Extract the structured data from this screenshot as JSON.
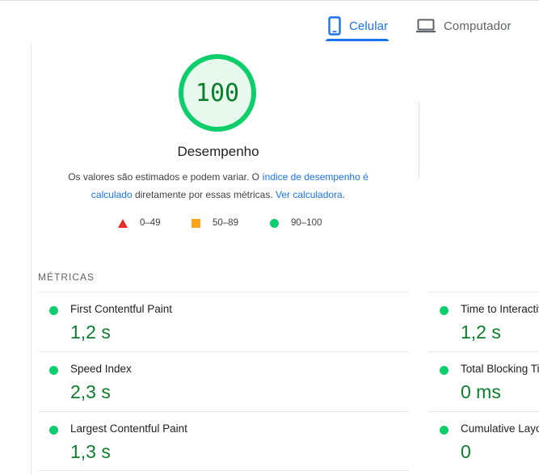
{
  "tabs": [
    {
      "label": "Celular",
      "icon": "smartphone-icon",
      "selected": true
    },
    {
      "label": "Computador",
      "icon": "laptop-icon",
      "selected": false
    }
  ],
  "gauge": {
    "score": "100",
    "score_fraction": 1.0,
    "title": "Desempenho",
    "color": "#0cce6b"
  },
  "description": {
    "text_1": "Os valores são estimados e podem variar. O ",
    "link_1": "índice de desempenho é calculado",
    "text_2": " diretamente por essas métricas. ",
    "link_2": "Ver calculadora",
    "text_3": "."
  },
  "legend": [
    {
      "range": "0–49",
      "shape": "triangle",
      "color": "#eb2a2a"
    },
    {
      "range": "50–89",
      "shape": "square",
      "color": "#ffa31f"
    },
    {
      "range": "90–100",
      "shape": "circle",
      "color": "#0cce6b"
    }
  ],
  "metrics_header": "MÉTRICAS",
  "metrics": [
    {
      "title": "First Contentful Paint",
      "value": "1,2 s"
    },
    {
      "title": "Time to Interactive",
      "value": "1,2 s"
    },
    {
      "title": "Speed Index",
      "value": "2,3 s"
    },
    {
      "title": "Total Blocking Time",
      "value": "0 ms"
    },
    {
      "title": "Largest Contentful Paint",
      "value": "1,3 s"
    },
    {
      "title": "Cumulative Layout Shift",
      "value": "0"
    }
  ],
  "colors": {
    "accent": "#1a73e8",
    "pass": "#0cce6b",
    "pass_text": "#0c7d2c"
  }
}
